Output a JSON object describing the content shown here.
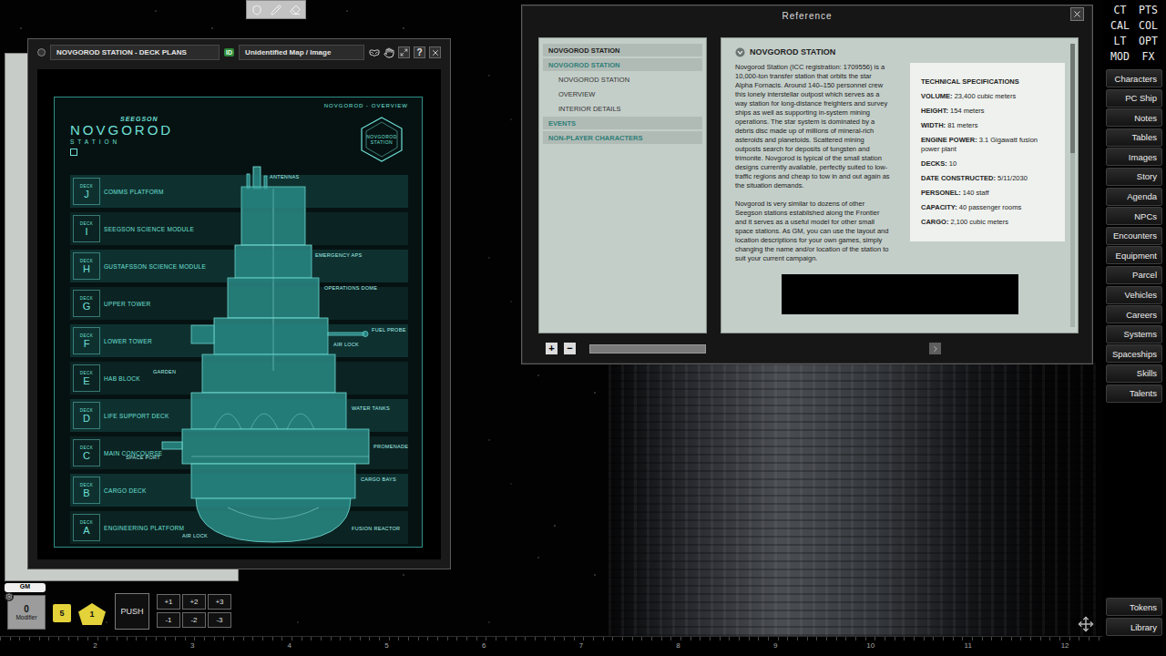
{
  "image_window": {
    "title": "NOVGOROD STATION - DECK PLANS",
    "id_badge": "ID",
    "name": "Unidentified Map / Image",
    "help": "?",
    "deck_plan": {
      "overview": "NOVGOROD - OVERVIEW",
      "brand": "SEEGSON",
      "title": "NOVGOROD",
      "subtitle": "STATION",
      "logo_lines": [
        "NOVGOROD",
        "STATION"
      ],
      "deck_label": "DECK",
      "decks": [
        {
          "letter": "J",
          "name": "COMMS PLATFORM"
        },
        {
          "letter": "I",
          "name": "SEEGSON SCIENCE MODULE"
        },
        {
          "letter": "H",
          "name": "GUSTAFSSON SCIENCE MODULE"
        },
        {
          "letter": "G",
          "name": "UPPER TOWER"
        },
        {
          "letter": "F",
          "name": "LOWER TOWER"
        },
        {
          "letter": "E",
          "name": "HAB BLOCK"
        },
        {
          "letter": "D",
          "name": "LIFE SUPPORT DECK"
        },
        {
          "letter": "C",
          "name": "MAIN CONCOURSE"
        },
        {
          "letter": "B",
          "name": "CARGO DECK"
        },
        {
          "letter": "A",
          "name": "ENGINEERING PLATFORM"
        }
      ],
      "callouts": [
        "ANTENNAS",
        "EMERGENCY APS",
        "OPERATIONS DOME",
        "FUEL PROBE",
        "AIR LOCK",
        "GARDEN",
        "WATER TANKS",
        "SPACE PORT",
        "PROMENADE",
        "CARGO BAYS",
        "AIR LOCK",
        "FUSION REACTOR"
      ]
    }
  },
  "reference_window": {
    "title": "Reference",
    "index": [
      {
        "label": "NOVGOROD STATION",
        "kind": "title"
      },
      {
        "label": "NOVGOROD STATION",
        "kind": "group"
      },
      {
        "label": "NOVGOROD STATION",
        "kind": "item"
      },
      {
        "label": "OVERVIEW",
        "kind": "item"
      },
      {
        "label": "INTERIOR DETAILS",
        "kind": "item"
      },
      {
        "label": "EVENTS",
        "kind": "group"
      },
      {
        "label": "NON-PLAYER CHARACTERS",
        "kind": "group"
      }
    ],
    "heading": "NOVGOROD STATION",
    "paragraphs": [
      "Novgorod Station (ICC registration: 1709556) is a 10,000-ton transfer station that orbits the star Alpha Fornacis. Around 140–150 personnel crew this lonely interstellar outpost which serves as a way station for long-distance freighters and survey ships as well as supporting in-system mining operations. The star system is dominated by a debris disc made up of millions of mineral-rich asteroids and planetoids. Scattered mining outposts search for deposits of tungsten and trimonite. Novgorod is typical of the small station designs currently available, perfectly suited to low-traffic regions and cheap to tow in and out again as the situation demands.",
      "Novgorod is very similar to dozens of other Seegson stations established along the Frontier and it serves as a useful model for other small space stations. As GM, you can use the layout and location descriptions for your own games, simply changing the name and/or location of the station to suit your current campaign."
    ],
    "specs": {
      "title": "TECHNICAL SPECIFICATIONS",
      "rows": [
        {
          "label": "VOLUME:",
          "value": "23,400 cubic meters"
        },
        {
          "label": "HEIGHT:",
          "value": "154 meters"
        },
        {
          "label": "WIDTH:",
          "value": "81 meters"
        },
        {
          "label": "ENGINE POWER:",
          "value": "3.1 Gigawatt fusion power plant"
        },
        {
          "label": "DECKS:",
          "value": "10"
        },
        {
          "label": "DATE CONSTRUCTED:",
          "value": "5/11/2030"
        },
        {
          "label": "PERSONEL:",
          "value": "140 staff"
        },
        {
          "label": "CAPACITY:",
          "value": "40 passenger rooms"
        },
        {
          "label": "CARGO:",
          "value": "2,100 cubic meters"
        }
      ]
    },
    "controls": {
      "plus": "+",
      "minus": "−"
    }
  },
  "sidebar": {
    "quick": [
      "CT",
      "PTS",
      "CAL",
      "COL",
      "LT",
      "OPT",
      "MOD",
      "FX"
    ],
    "items": [
      "Characters",
      "PC Ship",
      "Notes",
      "Tables",
      "Images",
      "Story",
      "Agenda",
      "NPCs",
      "Encounters",
      "Equipment",
      "Parcel",
      "Vehicles",
      "Careers",
      "Systems",
      "Spaceships",
      "Skills",
      "Talents"
    ],
    "bottom": [
      "Tokens",
      "Library"
    ]
  },
  "dice_tray": {
    "gm_label": "GM",
    "modifier": {
      "value": "0",
      "label": "Modifier"
    },
    "dice": [
      {
        "value": "5",
        "kind": "square"
      },
      {
        "value": "1",
        "kind": "d10"
      }
    ],
    "push": "PUSH",
    "mods": [
      "+1",
      "+2",
      "+3",
      "-1",
      "-2",
      "-3"
    ]
  },
  "ruler": [
    "2",
    "3",
    "4",
    "5",
    "6",
    "7",
    "8",
    "9",
    "10",
    "11",
    "12"
  ]
}
